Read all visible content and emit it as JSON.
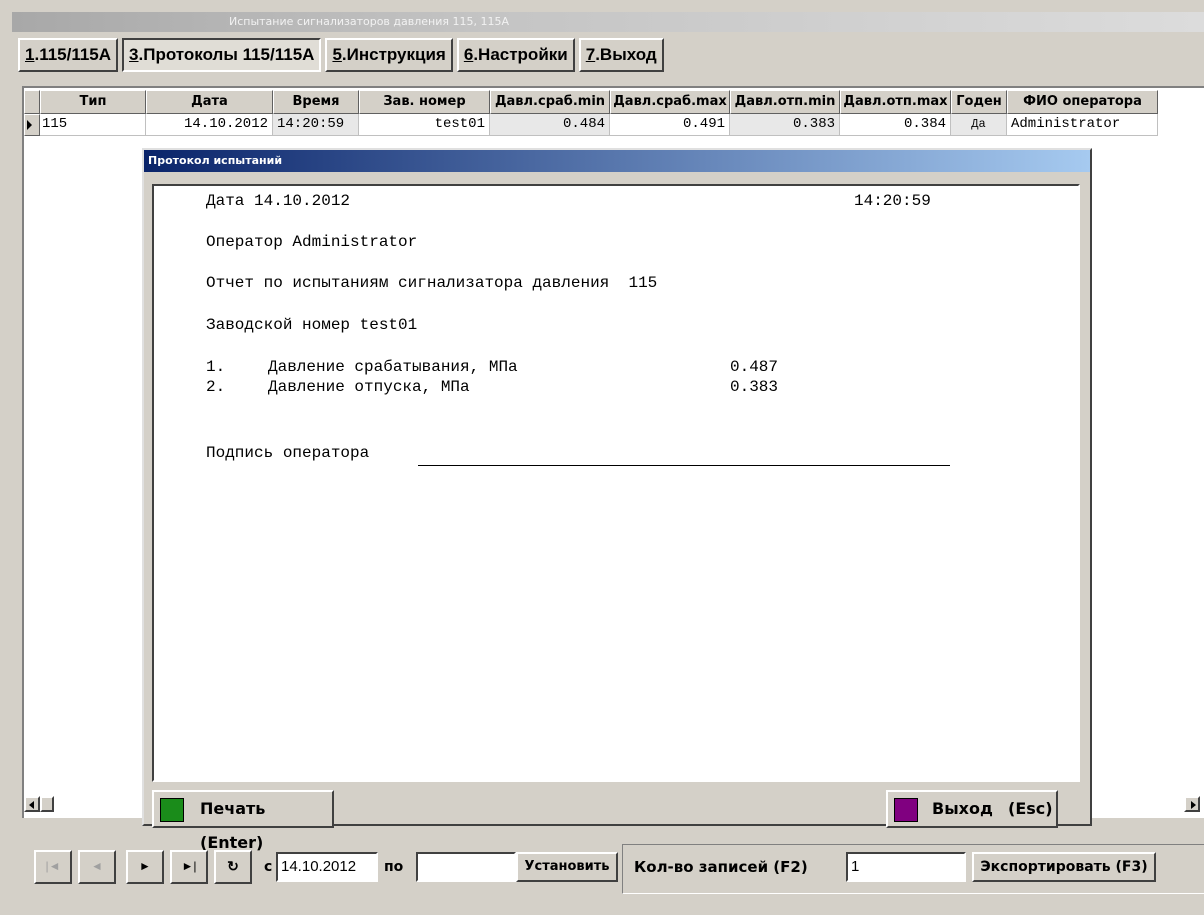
{
  "window": {
    "title": "Испытание сигнализаторов давления 115, 115А"
  },
  "tabs": [
    {
      "key": "1",
      "label": ".115/115А"
    },
    {
      "key": "3",
      "label": ".Протоколы 115/115А"
    },
    {
      "key": "5",
      "label": ".Инструкция"
    },
    {
      "key": "6",
      "label": ".Настройки"
    },
    {
      "key": "7",
      "label": ".Выход"
    }
  ],
  "grid": {
    "headers": [
      "Тип",
      "Дата",
      "Время",
      "Зав. номер",
      "Давл.сраб.min",
      "Давл.сраб.max",
      "Давл.отп.min",
      "Давл.отп.max",
      "Годен",
      "ФИО оператора"
    ],
    "rows": [
      [
        "115",
        "14.10.2012",
        "14:20:59",
        "test01",
        "0.484",
        "0.491",
        "0.383",
        "0.384",
        "Да",
        "Administrator"
      ]
    ]
  },
  "dialog": {
    "title": "Протокол испытаний",
    "report": {
      "date_line": "Дата 14.10.2012",
      "time": "14:20:59",
      "operator_line": "Оператор Administrator",
      "report_title": "Отчет по испытаниям сигнализатора давления  115",
      "serial_line": "Заводской номер test01",
      "item1_num": "1.",
      "item1_label": "Давление срабатывания, МПа",
      "item1_value": "0.487",
      "item2_num": "2.",
      "item2_label": "Давление отпуска, МПа",
      "item2_value": "0.383",
      "signature_label": "Подпись оператора"
    },
    "print_button": "Печать (Enter)",
    "exit_button_label": "Выход",
    "exit_button_key": "(Esc)",
    "print_color": "#1a8c1a",
    "exit_color": "#800080"
  },
  "bottom": {
    "nav": {
      "first": "|◄",
      "prev": "◄",
      "next": "►",
      "last": "►|",
      "refresh": "↻"
    },
    "from_label": "с",
    "from_value": "14.10.2012",
    "to_label": "по",
    "to_value": "",
    "set_button": "Установить",
    "count_label": "Кол-во записей (F2)",
    "count_value": "1",
    "export_button": "Экспортировать (F3)"
  }
}
